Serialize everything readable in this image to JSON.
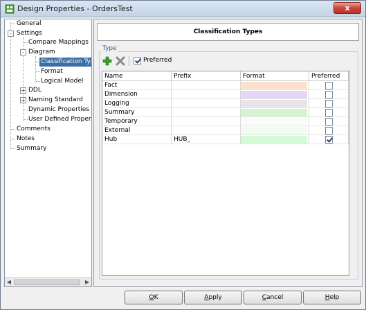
{
  "window": {
    "title": "Design Properties - OrdersTest",
    "close_label": "x"
  },
  "tree": {
    "items": [
      {
        "label": "General"
      },
      {
        "label": "Settings"
      },
      {
        "label": "Compare Mappings"
      },
      {
        "label": "Diagram"
      },
      {
        "label": "Classification Types"
      },
      {
        "label": "Format"
      },
      {
        "label": "Logical Model"
      },
      {
        "label": "DDL"
      },
      {
        "label": "Naming Standard"
      },
      {
        "label": "Dynamic Properties"
      },
      {
        "label": "User Defined Properties"
      },
      {
        "label": "Comments"
      },
      {
        "label": "Notes"
      },
      {
        "label": "Summary"
      }
    ],
    "expander_open": "-",
    "expander_closed": "+"
  },
  "panel": {
    "header": "Classification Types",
    "group_label": "Type",
    "preferred_label": "Preferred",
    "preferred_checked": true
  },
  "grid": {
    "columns": [
      "Name",
      "Prefix",
      "Format",
      "Preferred"
    ],
    "rows": [
      {
        "name": "Fact",
        "prefix": "",
        "color": "#fbe0cc",
        "preferred": false
      },
      {
        "name": "Dimension",
        "prefix": "",
        "color": "#e6d6f6",
        "preferred": false
      },
      {
        "name": "Logging",
        "prefix": "",
        "color": "#e9e4ec",
        "preferred": false
      },
      {
        "name": "Summary",
        "prefix": "",
        "color": "#d5f2d1",
        "preferred": false
      },
      {
        "name": "Temporary",
        "prefix": "",
        "color": "#f9fdf7",
        "preferred": false
      },
      {
        "name": "External",
        "prefix": "",
        "color": "#f3fbf1",
        "preferred": false
      },
      {
        "name": "Hub",
        "prefix": "HUB_",
        "color": "#d2fbd6",
        "preferred": true
      }
    ]
  },
  "buttons": {
    "ok": {
      "pre": "",
      "key": "O",
      "post": "K"
    },
    "apply": {
      "pre": "",
      "key": "A",
      "post": "pply"
    },
    "cancel": {
      "pre": "",
      "key": "C",
      "post": "ancel"
    },
    "help": {
      "pre": "",
      "key": "H",
      "post": "elp"
    }
  },
  "scroll_arrows": {
    "left": "◀",
    "right": "▶"
  }
}
